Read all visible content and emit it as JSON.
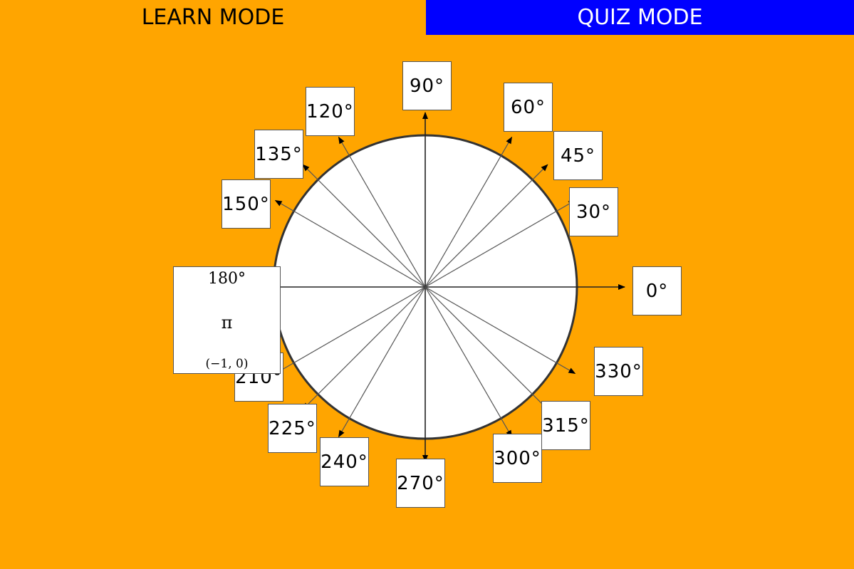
{
  "tabs": {
    "learn": "LEARN MODE",
    "quiz": "QUIZ MODE"
  },
  "colors": {
    "background": "#FFA500",
    "quiz_tab": "#0000FF"
  },
  "angles": [
    {
      "deg": 0,
      "label": "0°"
    },
    {
      "deg": 30,
      "label": "30°"
    },
    {
      "deg": 45,
      "label": "45°"
    },
    {
      "deg": 60,
      "label": "60°"
    },
    {
      "deg": 90,
      "label": "90°"
    },
    {
      "deg": 120,
      "label": "120°"
    },
    {
      "deg": 135,
      "label": "135°"
    },
    {
      "deg": 150,
      "label": "150°"
    },
    {
      "deg": 180,
      "label": "180°"
    },
    {
      "deg": 210,
      "label": "210°"
    },
    {
      "deg": 225,
      "label": "225°"
    },
    {
      "deg": 240,
      "label": "240°"
    },
    {
      "deg": 270,
      "label": "270°"
    },
    {
      "deg": 300,
      "label": "300°"
    },
    {
      "deg": 315,
      "label": "315°"
    },
    {
      "deg": 330,
      "label": "330°"
    }
  ],
  "selected": {
    "degrees": "180°",
    "radians": "π",
    "coordinates": "(−1, 0)"
  }
}
